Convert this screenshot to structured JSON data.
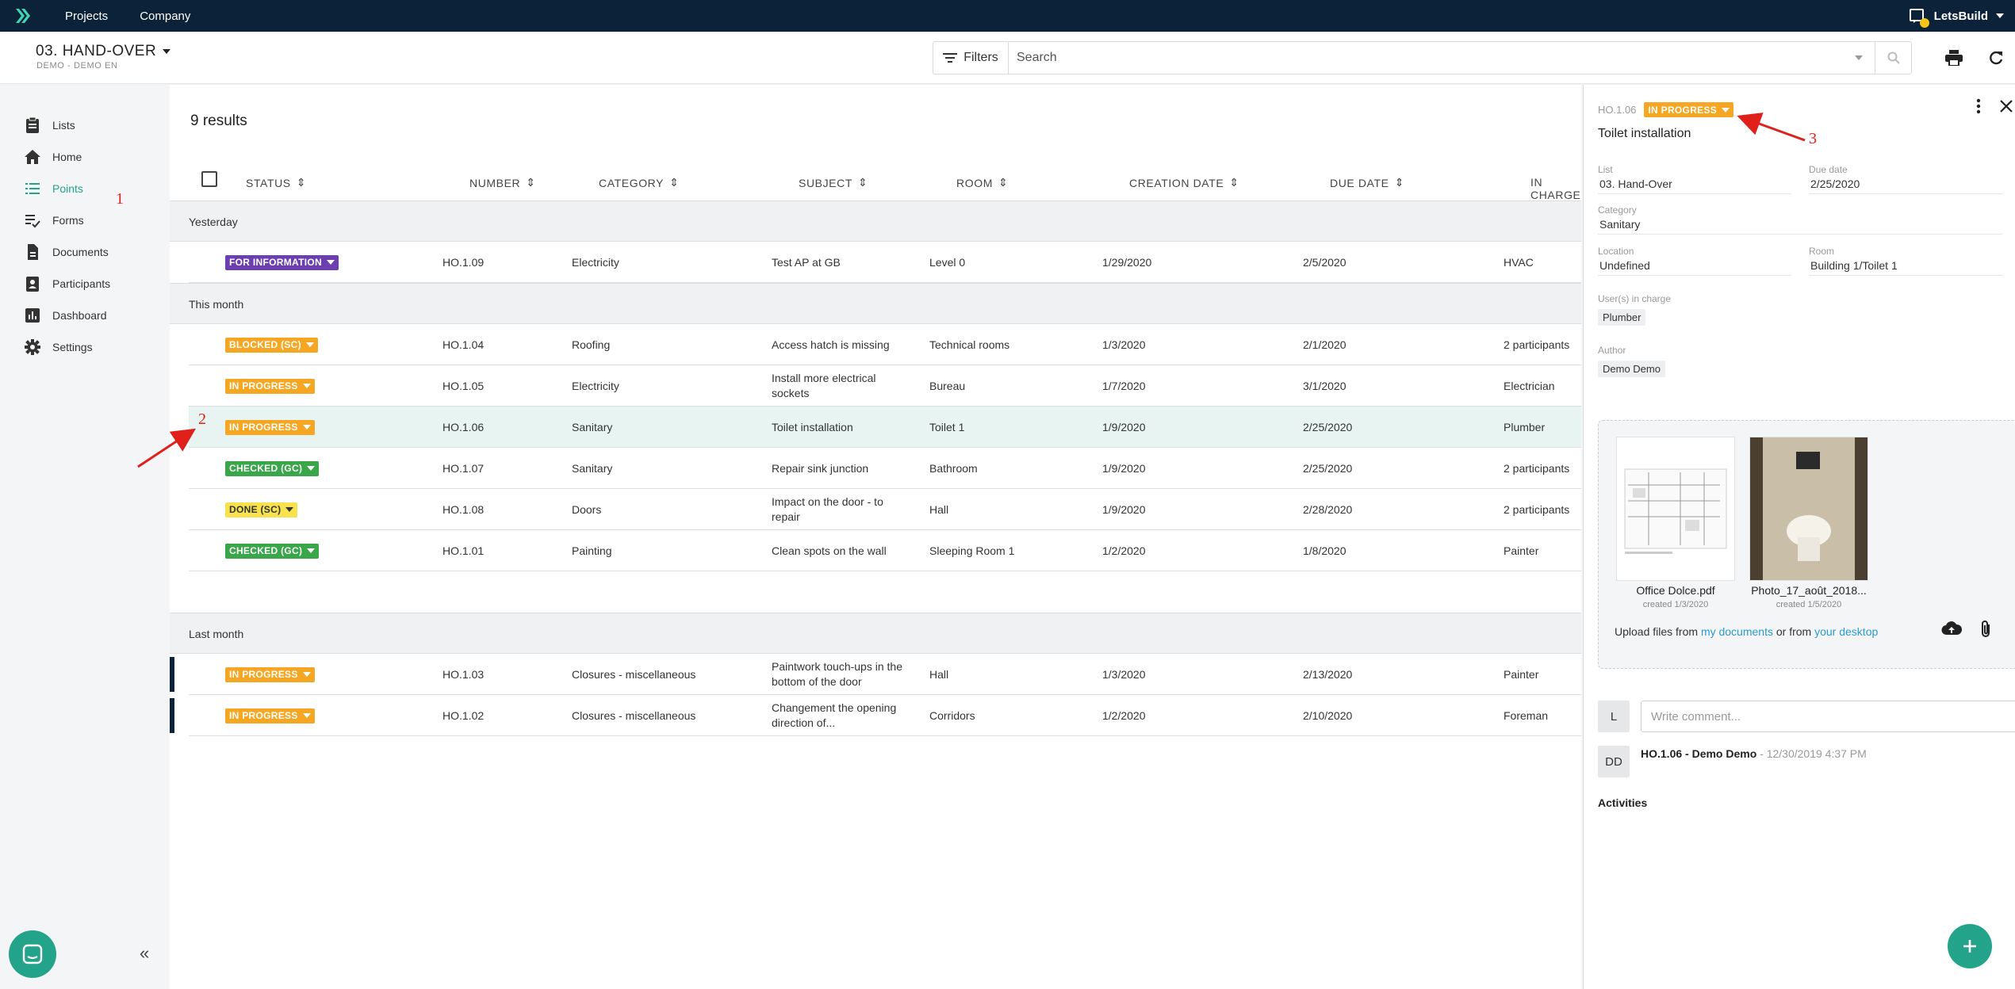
{
  "topbar": {
    "nav": [
      "Projects",
      "Company"
    ],
    "user": "LetsBuild"
  },
  "project": {
    "name": "03. HAND-OVER",
    "sub": "DEMO - DEMO EN"
  },
  "search": {
    "filters_label": "Filters",
    "placeholder": "Search"
  },
  "sidebar": {
    "items": [
      {
        "label": "Lists",
        "icon": "clipboard-icon"
      },
      {
        "label": "Home",
        "icon": "home-icon"
      },
      {
        "label": "Points",
        "icon": "list-icon",
        "active": true
      },
      {
        "label": "Forms",
        "icon": "checklist-icon"
      },
      {
        "label": "Documents",
        "icon": "document-icon"
      },
      {
        "label": "Participants",
        "icon": "contacts-icon"
      },
      {
        "label": "Dashboard",
        "icon": "chart-icon"
      },
      {
        "label": "Settings",
        "icon": "gear-icon"
      }
    ]
  },
  "list": {
    "results": "9 results",
    "columns": [
      "STATUS",
      "NUMBER",
      "CATEGORY",
      "SUBJECT",
      "ROOM",
      "CREATION DATE",
      "DUE DATE",
      "IN CHARGE"
    ],
    "groups": [
      "Yesterday",
      "This month",
      "Last month"
    ],
    "rows": [
      {
        "status": "FOR INFORMATION",
        "color": "#6b3fb0",
        "number": "HO.1.09",
        "category": "Electricity",
        "subject": "Test AP at GB",
        "room": "Level 0",
        "created": "1/29/2020",
        "due": "2/5/2020",
        "in_charge": "HVAC"
      },
      {
        "status": "BLOCKED (SC)",
        "color": "#f5a623",
        "number": "HO.1.04",
        "category": "Roofing",
        "subject": "Access hatch is missing",
        "room": "Technical rooms",
        "created": "1/3/2020",
        "due": "2/1/2020",
        "in_charge": "2 participants"
      },
      {
        "status": "IN PROGRESS",
        "color": "#f5a623",
        "number": "HO.1.05",
        "category": "Electricity",
        "subject": "Install more electrical sockets",
        "room": "Bureau",
        "created": "1/7/2020",
        "due": "3/1/2020",
        "in_charge": "Electrician"
      },
      {
        "status": "IN PROGRESS",
        "color": "#f5a623",
        "number": "HO.1.06",
        "category": "Sanitary",
        "subject": "Toilet installation",
        "room": "Toilet 1",
        "created": "1/9/2020",
        "due": "2/25/2020",
        "in_charge": "Plumber",
        "selected": true
      },
      {
        "status": "CHECKED (GC)",
        "color": "#3aa64a",
        "number": "HO.1.07",
        "category": "Sanitary",
        "subject": "Repair sink junction",
        "room": "Bathroom",
        "created": "1/9/2020",
        "due": "2/25/2020",
        "in_charge": "2 participants"
      },
      {
        "status": "DONE (SC)",
        "color": "#f7e14d",
        "text_color": "#333",
        "number": "HO.1.08",
        "category": "Doors",
        "subject": "Impact on the door - to repair",
        "room": "Hall",
        "created": "1/9/2020",
        "due": "2/28/2020",
        "in_charge": "2 participants"
      },
      {
        "status": "CHECKED (GC)",
        "color": "#3aa64a",
        "number": "HO.1.01",
        "category": "Painting",
        "subject": "Clean spots on the wall",
        "room": "Sleeping Room 1",
        "created": "1/2/2020",
        "due": "1/8/2020",
        "in_charge": "Painter"
      },
      {
        "status": "IN PROGRESS",
        "color": "#f5a623",
        "number": "HO.1.03",
        "category": "Closures - miscellaneous",
        "subject": "Paintwork touch-ups in the bottom of the door",
        "room": "Hall",
        "created": "1/3/2020",
        "due": "2/13/2020",
        "in_charge": "Painter",
        "bar": true
      },
      {
        "status": "IN PROGRESS",
        "color": "#f5a623",
        "number": "HO.1.02",
        "category": "Closures - miscellaneous",
        "subject": "Changement the opening direction of...",
        "room": "Corridors",
        "created": "1/2/2020",
        "due": "2/10/2020",
        "in_charge": "Foreman",
        "bar": true
      }
    ]
  },
  "detail": {
    "number": "HO.1.06",
    "status": "IN PROGRESS",
    "title": "Toilet installation",
    "fields": {
      "list": {
        "label": "List",
        "value": "03. Hand-Over"
      },
      "due": {
        "label": "Due date",
        "value": "2/25/2020"
      },
      "category": {
        "label": "Category",
        "value": "Sanitary"
      },
      "location": {
        "label": "Location",
        "value": "Undefined"
      },
      "room": {
        "label": "Room",
        "value": "Building 1/Toilet 1"
      },
      "users": {
        "label": "User(s) in charge",
        "value": "Plumber"
      },
      "author": {
        "label": "Author",
        "value": "Demo Demo"
      }
    },
    "attachments": [
      {
        "name": "Office Dolce.pdf",
        "date": "created 1/3/2020"
      },
      {
        "name": "Photo_17_août_2018...",
        "date": "created 1/5/2020"
      }
    ],
    "upload": {
      "prefix": "Upload files from",
      "link1": "my documents",
      "middle": "or from",
      "link2": "your desktop"
    },
    "comment": {
      "avatar": "L",
      "placeholder": "Write comment..."
    },
    "activity": {
      "avatar": "DD",
      "title": "HO.1.06 - Demo Demo",
      "time": " - 12/30/2019 4:37 PM"
    },
    "activities_label": "Activities"
  },
  "annotations": [
    "1",
    "2",
    "3"
  ],
  "colors": {
    "accent": "#24a38b",
    "topbar": "#0b2238",
    "annotation": "#e0211b"
  }
}
